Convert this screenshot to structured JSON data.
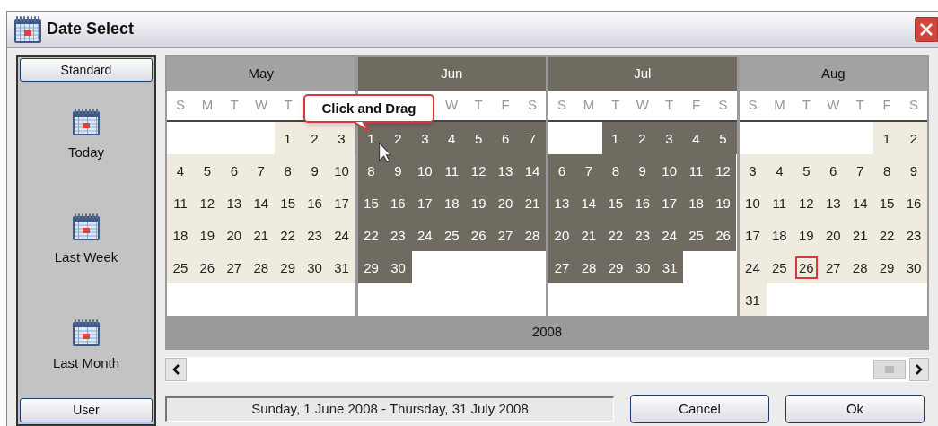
{
  "window": {
    "title": "Date Select"
  },
  "sidebar": {
    "top_button": "Standard",
    "items": [
      {
        "label": "Today"
      },
      {
        "label": "Last Week"
      },
      {
        "label": "Last Month"
      }
    ],
    "bottom_button": "User"
  },
  "calendar": {
    "months": [
      {
        "name": "May",
        "selected": false,
        "weekdays": {
          "kind": "head",
          "labels": [
            "S",
            "M",
            "T",
            "W",
            "T"
          ]
        },
        "weeks": [
          {
            "kind": "first",
            "days": [
              {
                "day": "1",
                "today": false
              },
              {
                "day": "2",
                "today": false
              },
              {
                "day": "3",
                "today": false
              }
            ]
          },
          {
            "kind": "full",
            "days": [
              {
                "day": "4",
                "today": false
              },
              {
                "day": "5",
                "today": false
              },
              {
                "day": "6",
                "today": false
              },
              {
                "day": "7",
                "today": false
              },
              {
                "day": "8",
                "today": false
              },
              {
                "day": "9",
                "today": false
              },
              {
                "day": "10",
                "today": false
              }
            ]
          },
          {
            "kind": "full",
            "days": [
              {
                "day": "11",
                "today": false
              },
              {
                "day": "12",
                "today": false
              },
              {
                "day": "13",
                "today": false
              },
              {
                "day": "14",
                "today": false
              },
              {
                "day": "15",
                "today": false
              },
              {
                "day": "16",
                "today": false
              },
              {
                "day": "17",
                "today": false
              }
            ]
          },
          {
            "kind": "full",
            "days": [
              {
                "day": "18",
                "today": false
              },
              {
                "day": "19",
                "today": false
              },
              {
                "day": "20",
                "today": false
              },
              {
                "day": "21",
                "today": false
              },
              {
                "day": "22",
                "today": false
              },
              {
                "day": "23",
                "today": false
              },
              {
                "day": "24",
                "today": false
              }
            ]
          },
          {
            "kind": "full",
            "days": [
              {
                "day": "25",
                "today": false
              },
              {
                "day": "26",
                "today": false
              },
              {
                "day": "27",
                "today": false
              },
              {
                "day": "28",
                "today": false
              },
              {
                "day": "29",
                "today": false
              },
              {
                "day": "30",
                "today": false
              },
              {
                "day": "31",
                "today": false
              }
            ]
          }
        ]
      },
      {
        "name": "Jun",
        "selected": true,
        "weekdays": {
          "kind": "tail",
          "labels": [
            "W",
            "T",
            "F",
            "S"
          ]
        },
        "weeks": [
          {
            "kind": "full",
            "days": [
              {
                "day": "1",
                "today": false
              },
              {
                "day": "2",
                "today": false
              },
              {
                "day": "3",
                "today": false
              },
              {
                "day": "4",
                "today": false
              },
              {
                "day": "5",
                "today": false
              },
              {
                "day": "6",
                "today": false
              },
              {
                "day": "7",
                "today": false
              }
            ]
          },
          {
            "kind": "full",
            "days": [
              {
                "day": "8",
                "today": false
              },
              {
                "day": "9",
                "today": false
              },
              {
                "day": "10",
                "today": false
              },
              {
                "day": "11",
                "today": false
              },
              {
                "day": "12",
                "today": false
              },
              {
                "day": "13",
                "today": false
              },
              {
                "day": "14",
                "today": false
              }
            ]
          },
          {
            "kind": "full",
            "days": [
              {
                "day": "15",
                "today": false
              },
              {
                "day": "16",
                "today": false
              },
              {
                "day": "17",
                "today": false
              },
              {
                "day": "18",
                "today": false
              },
              {
                "day": "19",
                "today": false
              },
              {
                "day": "20",
                "today": false
              },
              {
                "day": "21",
                "today": false
              }
            ]
          },
          {
            "kind": "full",
            "days": [
              {
                "day": "22",
                "today": false
              },
              {
                "day": "23",
                "today": false
              },
              {
                "day": "24",
                "today": false
              },
              {
                "day": "25",
                "today": false
              },
              {
                "day": "26",
                "today": false
              },
              {
                "day": "27",
                "today": false
              },
              {
                "day": "28",
                "today": false
              }
            ]
          },
          {
            "kind": "last",
            "days": [
              {
                "day": "29",
                "today": false
              },
              {
                "day": "30",
                "today": false
              }
            ]
          }
        ]
      },
      {
        "name": "Jul",
        "selected": true,
        "weekdays": {
          "kind": "full",
          "labels": [
            "S",
            "M",
            "T",
            "W",
            "T",
            "F",
            "S"
          ]
        },
        "weeks": [
          {
            "kind": "first",
            "days": [
              {
                "day": "1",
                "today": false
              },
              {
                "day": "2",
                "today": false
              },
              {
                "day": "3",
                "today": false
              },
              {
                "day": "4",
                "today": false
              },
              {
                "day": "5",
                "today": false
              }
            ]
          },
          {
            "kind": "full",
            "days": [
              {
                "day": "6",
                "today": false
              },
              {
                "day": "7",
                "today": false
              },
              {
                "day": "8",
                "today": false
              },
              {
                "day": "9",
                "today": false
              },
              {
                "day": "10",
                "today": false
              },
              {
                "day": "11",
                "today": false
              },
              {
                "day": "12",
                "today": false
              }
            ]
          },
          {
            "kind": "full",
            "days": [
              {
                "day": "13",
                "today": false
              },
              {
                "day": "14",
                "today": false
              },
              {
                "day": "15",
                "today": false
              },
              {
                "day": "16",
                "today": false
              },
              {
                "day": "17",
                "today": false
              },
              {
                "day": "18",
                "today": false
              },
              {
                "day": "19",
                "today": false
              }
            ]
          },
          {
            "kind": "full",
            "days": [
              {
                "day": "20",
                "today": false
              },
              {
                "day": "21",
                "today": false
              },
              {
                "day": "22",
                "today": false
              },
              {
                "day": "23",
                "today": false
              },
              {
                "day": "24",
                "today": false
              },
              {
                "day": "25",
                "today": false
              },
              {
                "day": "26",
                "today": false
              }
            ]
          },
          {
            "kind": "last",
            "days": [
              {
                "day": "27",
                "today": false
              },
              {
                "day": "28",
                "today": false
              },
              {
                "day": "29",
                "today": false
              },
              {
                "day": "30",
                "today": false
              },
              {
                "day": "31",
                "today": false
              }
            ]
          }
        ]
      },
      {
        "name": "Aug",
        "selected": false,
        "weekdays": {
          "kind": "full",
          "labels": [
            "S",
            "M",
            "T",
            "W",
            "T",
            "F",
            "S"
          ]
        },
        "weeks": [
          {
            "kind": "first",
            "days": [
              {
                "day": "1",
                "today": false
              },
              {
                "day": "2",
                "today": false
              }
            ]
          },
          {
            "kind": "full",
            "days": [
              {
                "day": "3",
                "today": false
              },
              {
                "day": "4",
                "today": false
              },
              {
                "day": "5",
                "today": false
              },
              {
                "day": "6",
                "today": false
              },
              {
                "day": "7",
                "today": false
              },
              {
                "day": "8",
                "today": false
              },
              {
                "day": "9",
                "today": false
              }
            ]
          },
          {
            "kind": "full",
            "days": [
              {
                "day": "10",
                "today": false
              },
              {
                "day": "11",
                "today": false
              },
              {
                "day": "12",
                "today": false
              },
              {
                "day": "13",
                "today": false
              },
              {
                "day": "14",
                "today": false
              },
              {
                "day": "15",
                "today": false
              },
              {
                "day": "16",
                "today": false
              }
            ]
          },
          {
            "kind": "full",
            "days": [
              {
                "day": "17",
                "today": false
              },
              {
                "day": "18",
                "today": false
              },
              {
                "day": "19",
                "today": false
              },
              {
                "day": "20",
                "today": false
              },
              {
                "day": "21",
                "today": false
              },
              {
                "day": "22",
                "today": false
              },
              {
                "day": "23",
                "today": false
              }
            ]
          },
          {
            "kind": "full",
            "days": [
              {
                "day": "24",
                "today": false
              },
              {
                "day": "25",
                "today": false
              },
              {
                "day": "26",
                "today": true
              },
              {
                "day": "27",
                "today": false
              },
              {
                "day": "28",
                "today": false
              },
              {
                "day": "29",
                "today": false
              },
              {
                "day": "30",
                "today": false
              }
            ]
          },
          {
            "kind": "last",
            "days": [
              {
                "day": "31",
                "today": false
              }
            ]
          }
        ]
      }
    ],
    "year": "2008",
    "callout": "Click and Drag"
  },
  "status": "Sunday, 1 June 2008 - Thursday, 31 July 2008",
  "buttons": [
    "Cancel",
    "Ok"
  ]
}
